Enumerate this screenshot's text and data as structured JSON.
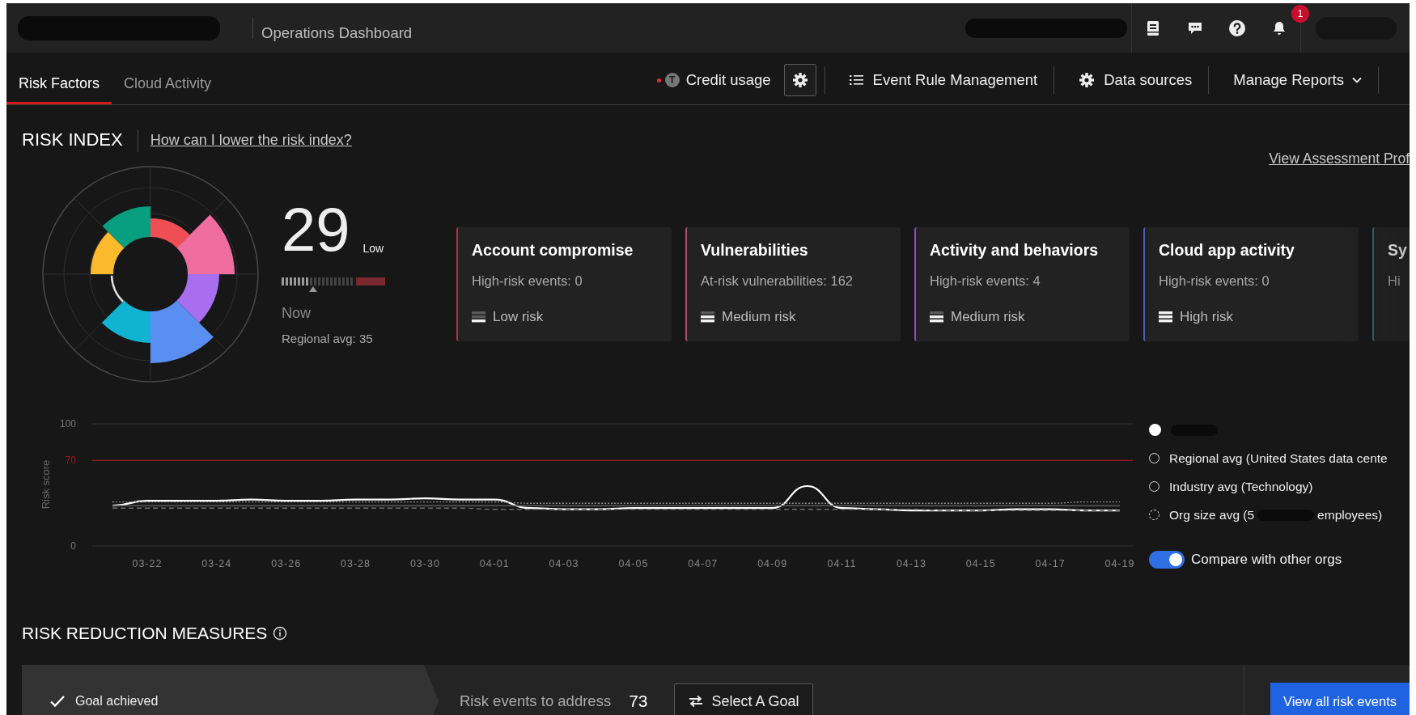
{
  "header": {
    "title": "Operations Dashboard",
    "notification_count": "1"
  },
  "tabs": [
    {
      "label": "Risk Factors",
      "selected": true
    },
    {
      "label": "Cloud Activity",
      "selected": false
    }
  ],
  "toolbar": {
    "credit": {
      "label": "Credit usage",
      "icon_letter": "T",
      "alert": true
    },
    "items": [
      {
        "kind": "settings"
      },
      {
        "kind": "list",
        "label": "Event Rule Management"
      },
      {
        "kind": "gear",
        "label": "Data sources"
      },
      {
        "kind": "dropdown",
        "label": "Manage Reports"
      }
    ]
  },
  "risk_index": {
    "title": "RISK INDEX",
    "help_link": "How can I lower the risk index?",
    "profile_link": "View Assessment Prof",
    "score": "29",
    "rating": "Low",
    "meter": {
      "level": 0.29
    },
    "period": "Now",
    "regional_avg": "Regional avg: 35"
  },
  "cards": [
    {
      "title": "Account compromise",
      "detail": "High-risk events: 0",
      "risk": "Low risk",
      "kind": "low",
      "color": "#a8344a"
    },
    {
      "title": "Vulnerabilities",
      "detail": "At-risk vulnerabilities: 162",
      "risk": "Medium risk",
      "kind": "medium",
      "color": "#b84a70"
    },
    {
      "title": "Activity and behaviors",
      "detail": "High-risk events: 4",
      "risk": "Medium risk",
      "kind": "medium",
      "color": "#8a4cc0"
    },
    {
      "title": "Cloud app activity",
      "detail": "High-risk events: 0",
      "risk": "High risk",
      "kind": "high",
      "color": "#4a5fb0"
    },
    {
      "title": "Sy",
      "detail": "Hi",
      "color": "#2c6a78"
    }
  ],
  "trend": {
    "chart_data": {
      "type": "line",
      "ylabel": "Risk score",
      "categories": [
        null,
        "03-22",
        null,
        "03-24",
        null,
        "03-26",
        null,
        "03-28",
        null,
        "03-30",
        null,
        "04-01",
        null,
        "04-03",
        null,
        "04-05",
        null,
        "04-07",
        null,
        "04-09",
        null,
        "04-11",
        null,
        "04-13",
        null,
        "04-15",
        null,
        "04-17",
        null,
        "04-19"
      ],
      "ylim": [
        0,
        100
      ],
      "yticks": [
        0,
        70,
        100
      ],
      "ref_lines": [
        {
          "axis": "y",
          "value": 70
        }
      ],
      "series": [
        {
          "color": "#ffffff",
          "line_style": "solid",
          "values": [
            33,
            37,
            37,
            37,
            38,
            37,
            37,
            38,
            38,
            39,
            38,
            38,
            31,
            30,
            30,
            31,
            31,
            31,
            31,
            31,
            49,
            31,
            30,
            29,
            29,
            29,
            30,
            30,
            29,
            29
          ]
        },
        {
          "name": "Regional avg (United States data cente",
          "color": "#8c8c8c",
          "line_style": "dotted",
          "values": [
            36,
            36,
            36,
            36,
            36,
            36,
            36,
            36,
            36,
            36,
            36,
            36,
            35,
            35,
            35,
            35,
            35,
            35,
            35,
            35,
            35,
            35,
            35,
            35,
            35,
            35,
            35,
            35,
            36,
            36
          ]
        },
        {
          "name": "Industry avg (Technology)",
          "color": "#5a5a5a",
          "line_style": "solid",
          "values": [
            33,
            33,
            33,
            33,
            33,
            33,
            33,
            33,
            33,
            33,
            33,
            33,
            33,
            33,
            33,
            33,
            33,
            33,
            33,
            33,
            33,
            33,
            33,
            33,
            33,
            33,
            33,
            33,
            33,
            33
          ]
        },
        {
          "name": "Org size avg (5",
          "color": "#6c6c6c",
          "line_style": "dashed",
          "values": [
            31,
            31,
            31,
            31,
            31,
            31,
            31,
            31,
            31,
            31,
            31,
            30,
            30,
            30,
            30,
            30,
            30,
            30,
            30,
            30,
            30,
            30,
            30,
            30,
            29,
            29,
            29,
            29,
            29,
            29
          ]
        }
      ]
    },
    "org_size_suffix": "employees)",
    "compare": {
      "label": "Compare with other orgs",
      "on": true
    }
  },
  "reduction": {
    "title": "RISK REDUCTION MEASURES",
    "goal": {
      "label": "Goal achieved",
      "achieved": true
    },
    "events_label": "Risk events to address",
    "events_count": "73",
    "select_goal": "Select A Goal",
    "view_all": "View all risk events"
  }
}
